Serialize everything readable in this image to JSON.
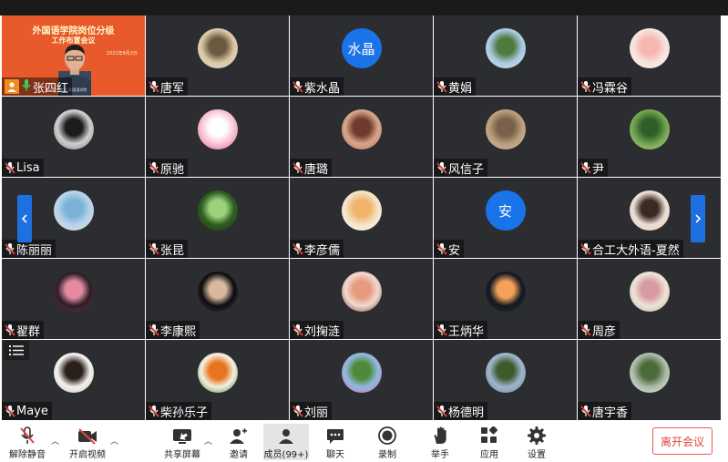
{
  "host": {
    "title_line1": "外国语学院岗位分级",
    "title_line2": "工作布置会议",
    "date": "2022年8月3日",
    "footer": "合肥工业大学 外国语学院",
    "name": "张四红"
  },
  "participants": [
    {
      "name": "唐军",
      "avatar": {
        "type": "photo",
        "colors": [
          "#d9c6a5",
          "#6b5a42",
          "#e8dfcf"
        ]
      }
    },
    {
      "name": "紫水晶",
      "avatar": {
        "type": "text",
        "text": "水晶",
        "color": "#1a73e8"
      }
    },
    {
      "name": "黄娟",
      "avatar": {
        "type": "photo",
        "colors": [
          "#a8c7e0",
          "#4f7a3d",
          "#dfe9ef"
        ]
      }
    },
    {
      "name": "冯霖谷",
      "avatar": {
        "type": "photo",
        "colors": [
          "#f6e3de",
          "#f5b7b0",
          "#fbefe9"
        ]
      }
    },
    {
      "name": "Lisa",
      "avatar": {
        "type": "photo",
        "colors": [
          "#cfcfcf",
          "#1c1c1c",
          "#7d7d7d"
        ]
      }
    },
    {
      "name": "原驰",
      "avatar": {
        "type": "photo",
        "colors": [
          "#f9c5d5",
          "#ffffff",
          "#e25c8a"
        ]
      }
    },
    {
      "name": "唐璐",
      "avatar": {
        "type": "photo",
        "colors": [
          "#d6a48b",
          "#6d3a2c",
          "#b97a5f"
        ]
      }
    },
    {
      "name": "风信子",
      "avatar": {
        "type": "photo",
        "colors": [
          "#b89c7c",
          "#7a6048",
          "#d8c7ad"
        ]
      }
    },
    {
      "name": "尹",
      "avatar": {
        "type": "photo",
        "colors": [
          "#6fa24f",
          "#2f5f27",
          "#c7d88a"
        ]
      }
    },
    {
      "name": "陈丽丽",
      "avatar": {
        "type": "photo",
        "colors": [
          "#b7d3ea",
          "#7bb1d6",
          "#e8e1d3"
        ]
      }
    },
    {
      "name": "张昆",
      "avatar": {
        "type": "photo",
        "colors": [
          "#2f5e20",
          "#9bd27b",
          "#1d3b12"
        ]
      }
    },
    {
      "name": "李彦儒",
      "avatar": {
        "type": "photo",
        "colors": [
          "#f4e2c6",
          "#f0b46a",
          "#ffffff"
        ]
      }
    },
    {
      "name": "安",
      "avatar": {
        "type": "text",
        "text": "安",
        "color": "#1a73e8"
      }
    },
    {
      "name": "合工大外语-夏然",
      "avatar": {
        "type": "photo",
        "colors": [
          "#e9dfd6",
          "#3a2a22",
          "#f0cdb8"
        ]
      }
    },
    {
      "name": "翟群",
      "avatar": {
        "type": "photo",
        "colors": [
          "#2b1f28",
          "#e58aa0",
          "#8a2c43"
        ]
      }
    },
    {
      "name": "李康熙",
      "avatar": {
        "type": "photo",
        "colors": [
          "#0d0d10",
          "#d8b9a0",
          "#4a3a3f"
        ]
      }
    },
    {
      "name": "刘掬涟",
      "avatar": {
        "type": "photo",
        "colors": [
          "#f3d9cf",
          "#e69a80",
          "#5a3a2c"
        ]
      }
    },
    {
      "name": "王炳华",
      "avatar": {
        "type": "photo",
        "colors": [
          "#151821",
          "#f3a15b",
          "#2a2d3a"
        ]
      }
    },
    {
      "name": "周彦",
      "avatar": {
        "type": "photo",
        "colors": [
          "#ece4d8",
          "#d99ba2",
          "#bfae98"
        ]
      }
    },
    {
      "name": "Maye",
      "avatar": {
        "type": "photo",
        "colors": [
          "#f2f2f0",
          "#2a1f1a",
          "#d8b9a1"
        ]
      }
    },
    {
      "name": "柴孙乐子",
      "avatar": {
        "type": "photo",
        "colors": [
          "#f6efe4",
          "#e8741e",
          "#3d7a2a"
        ]
      }
    },
    {
      "name": "刘丽",
      "avatar": {
        "type": "photo",
        "colors": [
          "#8fb9e0",
          "#4f8a3a",
          "#e26aa6"
        ]
      }
    },
    {
      "name": "杨德明",
      "avatar": {
        "type": "photo",
        "colors": [
          "#9fb6cc",
          "#3e5b2e",
          "#6d7f8f"
        ]
      }
    },
    {
      "name": "唐宇香",
      "avatar": {
        "type": "photo",
        "colors": [
          "#aab9a8",
          "#4c6b3a",
          "#e6ece2"
        ]
      }
    }
  ],
  "toolbar": {
    "unmute": "解除静音",
    "start_video": "开启视频",
    "share_screen": "共享屏幕",
    "invite": "邀请",
    "members": "成员(99+)",
    "chat": "聊天",
    "record": "录制",
    "raise_hand": "举手",
    "apps": "应用",
    "settings": "设置",
    "leave": "离开会议"
  },
  "colors": {
    "tile_bg": "#2b2d31",
    "accent_blue": "#1a73e8",
    "host_bg": "#e85a2c",
    "leave_red": "#e8403f"
  }
}
